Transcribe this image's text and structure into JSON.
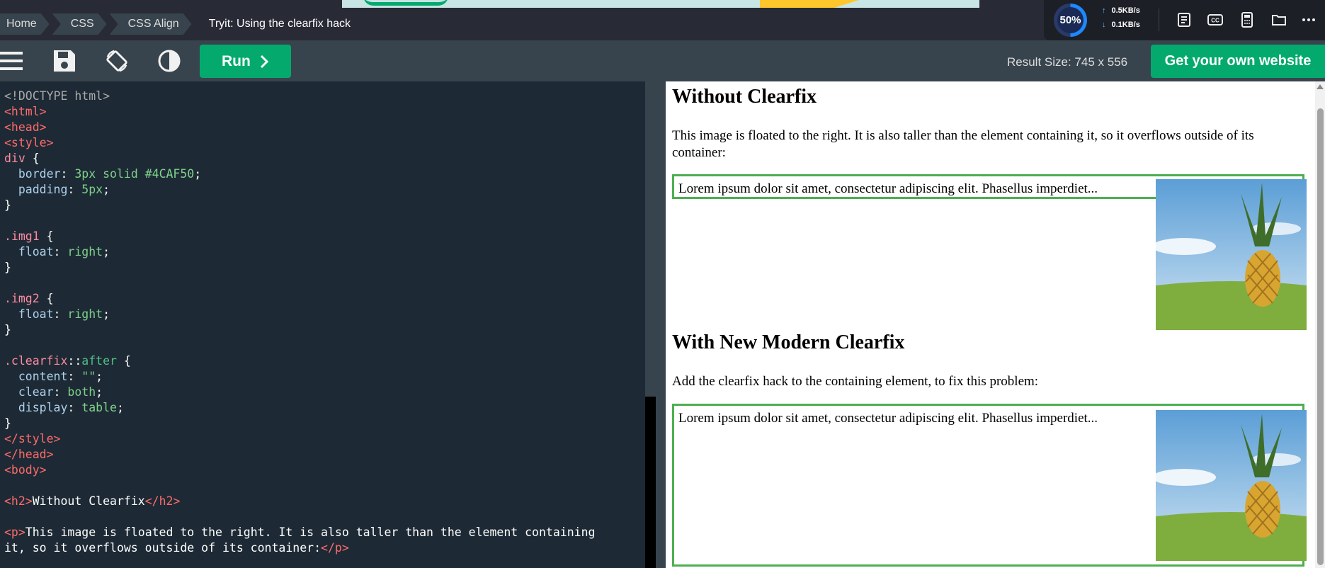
{
  "breadcrumb": {
    "items": [
      "Home",
      "CSS",
      "CSS Align"
    ],
    "current": "Tryit: Using the clearfix hack"
  },
  "tray": {
    "gauge_label": "50%",
    "upload": "0.5KB/s",
    "download": "0.1KB/s",
    "icons": [
      "notes-icon",
      "cc-icon",
      "calculator-icon",
      "folder-icon",
      "more-icon"
    ]
  },
  "toolbar": {
    "run_label": "Run",
    "result_size": "Result Size: 745 x 556",
    "own_website": "Get your own website",
    "icons": [
      "menu-icon",
      "save-icon",
      "rotate-icon",
      "contrast-icon"
    ]
  },
  "editor": {
    "lines": [
      [
        {
          "c": "t-doc",
          "t": "<!DOCTYPE html>"
        }
      ],
      [
        {
          "c": "t-tag",
          "t": "<html>"
        }
      ],
      [
        {
          "c": "t-tag",
          "t": "<head>"
        }
      ],
      [
        {
          "c": "t-tag",
          "t": "<style>"
        }
      ],
      [
        {
          "c": "t-sel",
          "t": "div "
        },
        {
          "c": "t-pun",
          "t": "{"
        }
      ],
      [
        {
          "c": "t-prop",
          "t": "  border"
        },
        {
          "c": "t-pun",
          "t": ": "
        },
        {
          "c": "t-val2",
          "t": "3px solid #4CAF50"
        },
        {
          "c": "t-pun",
          "t": ";"
        }
      ],
      [
        {
          "c": "t-prop",
          "t": "  padding"
        },
        {
          "c": "t-pun",
          "t": ": "
        },
        {
          "c": "t-val2",
          "t": "5px"
        },
        {
          "c": "t-pun",
          "t": ";"
        }
      ],
      [
        {
          "c": "t-pun",
          "t": "}"
        }
      ],
      [
        {
          "c": "t-pun",
          "t": ""
        }
      ],
      [
        {
          "c": "t-sel",
          "t": ".img1 "
        },
        {
          "c": "t-pun",
          "t": "{"
        }
      ],
      [
        {
          "c": "t-prop",
          "t": "  float"
        },
        {
          "c": "t-pun",
          "t": ": "
        },
        {
          "c": "t-val2",
          "t": "right"
        },
        {
          "c": "t-pun",
          "t": ";"
        }
      ],
      [
        {
          "c": "t-pun",
          "t": "}"
        }
      ],
      [
        {
          "c": "t-pun",
          "t": ""
        }
      ],
      [
        {
          "c": "t-sel",
          "t": ".img2 "
        },
        {
          "c": "t-pun",
          "t": "{"
        }
      ],
      [
        {
          "c": "t-prop",
          "t": "  float"
        },
        {
          "c": "t-pun",
          "t": ": "
        },
        {
          "c": "t-val2",
          "t": "right"
        },
        {
          "c": "t-pun",
          "t": ";"
        }
      ],
      [
        {
          "c": "t-pun",
          "t": "}"
        }
      ],
      [
        {
          "c": "t-pun",
          "t": ""
        }
      ],
      [
        {
          "c": "t-sel",
          "t": ".clearfix"
        },
        {
          "c": "t-pun",
          "t": "::"
        },
        {
          "c": "t-pseudo",
          "t": "after"
        },
        {
          "c": "t-pun",
          "t": " {"
        }
      ],
      [
        {
          "c": "t-prop",
          "t": "  content"
        },
        {
          "c": "t-pun",
          "t": ": "
        },
        {
          "c": "t-val2",
          "t": "\"\""
        },
        {
          "c": "t-pun",
          "t": ";"
        }
      ],
      [
        {
          "c": "t-prop",
          "t": "  clear"
        },
        {
          "c": "t-pun",
          "t": ": "
        },
        {
          "c": "t-val2",
          "t": "both"
        },
        {
          "c": "t-pun",
          "t": ";"
        }
      ],
      [
        {
          "c": "t-prop",
          "t": "  display"
        },
        {
          "c": "t-pun",
          "t": ": "
        },
        {
          "c": "t-val2",
          "t": "table"
        },
        {
          "c": "t-pun",
          "t": ";"
        }
      ],
      [
        {
          "c": "t-pun",
          "t": "}"
        }
      ],
      [
        {
          "c": "t-tag",
          "t": "</style>"
        }
      ],
      [
        {
          "c": "t-tag",
          "t": "</head>"
        }
      ],
      [
        {
          "c": "t-tag",
          "t": "<body>"
        }
      ],
      [
        {
          "c": "t-pun",
          "t": ""
        }
      ],
      [
        {
          "c": "t-tag",
          "t": "<h2>"
        },
        {
          "c": "t-pun",
          "t": "Without Clearfix"
        },
        {
          "c": "t-tag",
          "t": "</h2>"
        }
      ],
      [
        {
          "c": "t-pun",
          "t": ""
        }
      ],
      [
        {
          "c": "t-tag",
          "t": "<p>"
        },
        {
          "c": "t-pun",
          "t": "This image is floated to the right. It is also taller than the element containing"
        }
      ],
      [
        {
          "c": "t-pun",
          "t": "it, so it overflows outside of its container:"
        },
        {
          "c": "t-tag",
          "t": "</p>"
        }
      ]
    ]
  },
  "result": {
    "h2_without": "Without Clearfix",
    "p_without": "This image is floated to the right. It is also taller than the element containing it, so it overflows outside of its container:",
    "box_text_1": "Lorem ipsum dolor sit amet, consectetur adipiscing elit. Phasellus imperdiet...",
    "h2_with": "With New Modern Clearfix",
    "p_with": "Add the clearfix hack to the containing element, to fix this problem:",
    "box_text_2": "Lorem ipsum dolor sit amet, consectetur adipiscing elit. Phasellus imperdiet..."
  }
}
